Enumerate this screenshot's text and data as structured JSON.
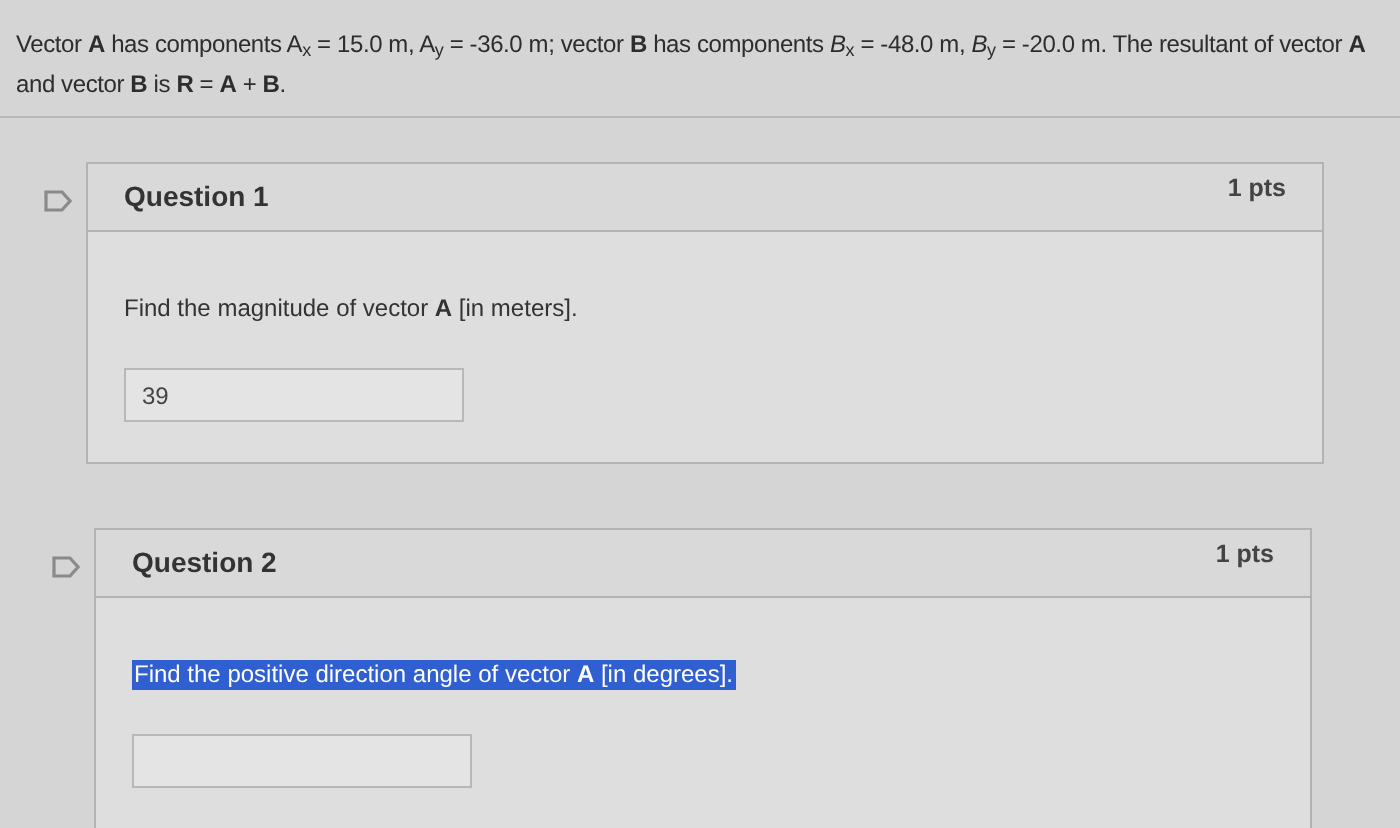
{
  "problem": "Vector **A** has components A$_{x}$ = 15.0 m, A$_{y}$ = -36.0 m; vector **B** has components *B*$_{x}$ = -48.0 m, *B*$_{y}$ = -20.0 m. The resultant of vector **A** and vector **B** is **R** = **A** + **B**.",
  "questions": [
    {
      "title": "Question 1",
      "points": "1 pts",
      "prompt": "Find the magnitude of vector **A** [in meters].",
      "highlighted": false,
      "answer": {
        "value": "39"
      }
    },
    {
      "title": "Question 2",
      "points": "1 pts",
      "prompt": "Find the positive direction angle of vector **A** [in degrees].",
      "highlighted": true
    }
  ]
}
